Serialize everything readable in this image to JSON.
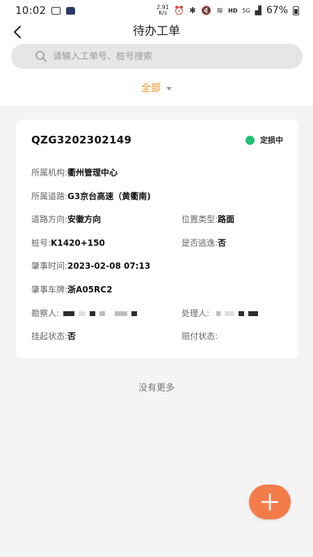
{
  "status_bar": {
    "time": "10:02",
    "net_speed_value": "2.91",
    "net_speed_unit": "K/s",
    "hd": "HD",
    "signal": "5G",
    "battery": "67%"
  },
  "header": {
    "title": "待办工单"
  },
  "search": {
    "placeholder": "请输入工单号、桩号搜索"
  },
  "filter": {
    "label": "全部"
  },
  "card": {
    "order_no": "QZG3202302149",
    "status": "定损中",
    "status_color": "#22c074",
    "org_label": "所属机构:",
    "org_value": "衢州管理中心",
    "road_label": "所属道路:",
    "road_value": "G3京台高速（黄衢南)",
    "direction_label": "道路方向:",
    "direction_value": "安徽方向",
    "location_type_label": "位置类型:",
    "location_type_value": "路面",
    "stake_label": "桩号:",
    "stake_value": "K1420+150",
    "escape_label": "是否逃逸:",
    "escape_value": "否",
    "time_label": "肇事时间:",
    "time_value": "2023-02-08 07:13",
    "plate_label": "肇事车牌:",
    "plate_value": "浙A05RC2",
    "surveyor_label": "勘察人:",
    "handler_label": "处理人:",
    "suspend_label": "挂起状态:",
    "suspend_value": "否",
    "pay_label": "赔付状态:",
    "pay_value": ""
  },
  "list": {
    "no_more": "没有更多"
  },
  "colors": {
    "accent": "#f0921c",
    "fab": "#f47c4b"
  }
}
